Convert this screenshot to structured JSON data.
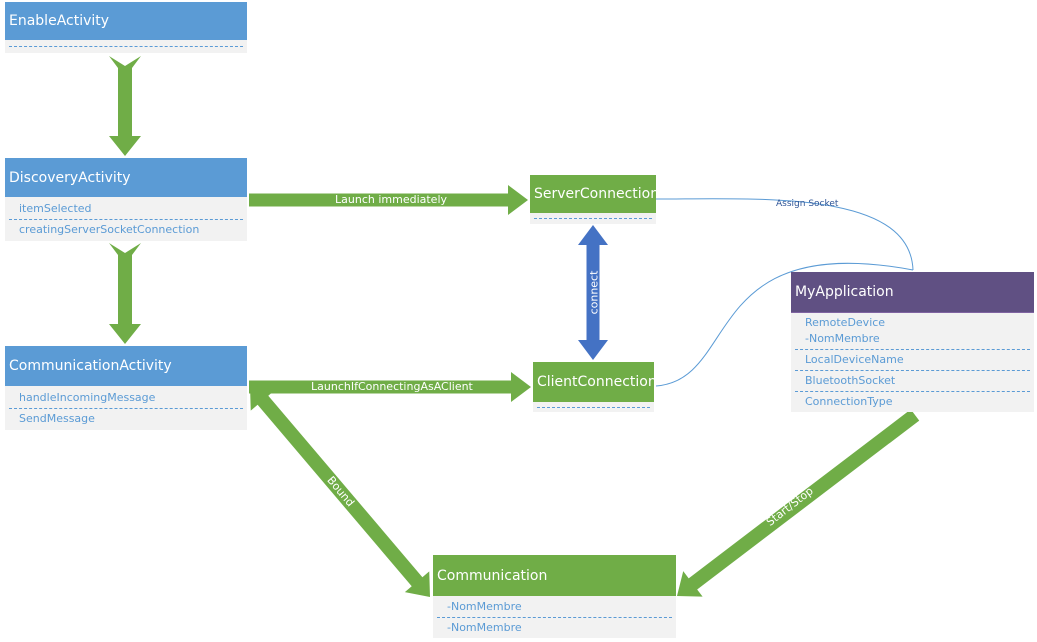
{
  "colors": {
    "activity": "#5b9bd5",
    "connection": "#70ad47",
    "application": "#605083",
    "arrow": "#70ad47",
    "connect_arrow": "#4472c4",
    "line": "#5b9bd5"
  },
  "boxes": {
    "enable": {
      "title": "EnableActivity",
      "items": []
    },
    "discovery": {
      "title": "DiscoveryActivity",
      "items": [
        "itemSelected",
        "creatingServerSocketConnection"
      ]
    },
    "communication_activity": {
      "title": "CommunicationActivity",
      "items": [
        "handleIncomingMessage",
        "SendMessage"
      ]
    },
    "server": {
      "title": "ServerConnection",
      "items": []
    },
    "client": {
      "title": "ClientConnection",
      "items": []
    },
    "myapp": {
      "title": "MyApplication",
      "items": [
        "RemoteDevice",
        "-NomMembre",
        "LocalDeviceName",
        "BluetoothSocket",
        "ConnectionType"
      ]
    },
    "communication": {
      "title": "Communication",
      "items": [
        "-NomMembre",
        "-NomMembre"
      ]
    }
  },
  "labels": {
    "launch_immediately": "Launch immediately",
    "launch_client": "LaunchIfConnectingAsAClient",
    "connect": "connect",
    "bound": "Bound",
    "start_stop": "Start/Stop",
    "assign_socket": "Assign Socket"
  }
}
